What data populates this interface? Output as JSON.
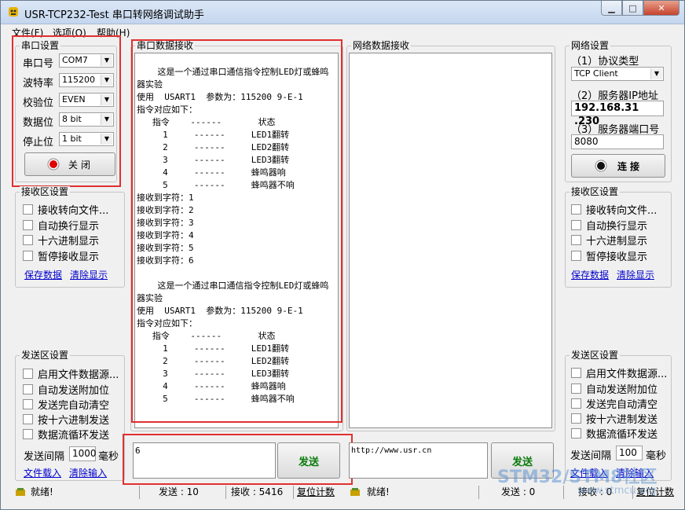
{
  "window": {
    "title": "USR-TCP232-Test 串口转网络调试助手"
  },
  "menu": [
    "文件(F)",
    "选项(O)",
    "帮助(H)"
  ],
  "serial_settings": {
    "title": "串口设置",
    "port_label": "串口号",
    "port_value": "COM7",
    "baud_label": "波特率",
    "baud_value": "115200",
    "parity_label": "校验位",
    "parity_value": "EVEN",
    "databits_label": "数据位",
    "databits_value": "8 bit",
    "stopbits_label": "停止位",
    "stopbits_value": "1 bit",
    "close_button": "关闭"
  },
  "left_receive": {
    "title": "接收区设置",
    "options": [
      "接收转向文件...",
      "自动换行显示",
      "十六进制显示",
      "暂停接收显示"
    ],
    "save_link": "保存数据",
    "clear_link": "清除显示"
  },
  "left_send": {
    "title": "发送区设置",
    "options": [
      "启用文件数据源...",
      "自动发送附加位",
      "发送完自动清空",
      "按十六进制发送",
      "数据流循环发送"
    ],
    "interval_label": "发送间隔",
    "interval_value": "1000",
    "interval_unit": "毫秒",
    "load_link": "文件载入",
    "clear_link": "清除输入"
  },
  "serial_receive": {
    "title": "串口数据接收",
    "content": "\n    这是一个通过串口通信指令控制LED灯或蜂鸣\n器实验\n使用  USART1  参数为：115200 9-E-1\n指令对应如下：\n   指令    ------       状态\n     1     ------     LED1翻转\n     2     ------     LED2翻转\n     3     ------     LED3翻转\n     4     ------     蜂鸣器响\n     5     ------     蜂鸣器不响\n接收到字符：1\n接收到字符：2\n接收到字符：3\n接收到字符：4\n接收到字符：5\n接收到字符：6\n\n    这是一个通过串口通信指令控制LED灯或蜂鸣\n器实验\n使用  USART1  参数为：115200 9-E-1\n指令对应如下：\n   指令    ------       状态\n     1     ------     LED1翻转\n     2     ------     LED2翻转\n     3     ------     LED3翻转\n     4     ------     蜂鸣器响\n     5     ------     蜂鸣器不响"
  },
  "network_receive": {
    "title": "网络数据接收"
  },
  "serial_send": {
    "input_value": "6",
    "send_button": "发送"
  },
  "network_send": {
    "input_value": "http://www.usr.cn",
    "send_button": "发送"
  },
  "network_settings": {
    "title": "网络设置",
    "protocol_label": "（1）协议类型",
    "protocol_value": "TCP Client",
    "ip_label": "（2）服务器IP地址",
    "ip_value": "192.168.31 .230",
    "port_label": "（3）服务器端口号",
    "port_value": "8080",
    "connect_button": "连接"
  },
  "right_receive": {
    "title": "接收区设置",
    "options": [
      "接收转向文件...",
      "自动换行显示",
      "十六进制显示",
      "暂停接收显示"
    ],
    "save_link": "保存数据",
    "clear_link": "清除显示"
  },
  "right_send": {
    "title": "发送区设置",
    "options": [
      "启用文件数据源...",
      "自动发送附加位",
      "发送完自动清空",
      "按十六进制发送",
      "数据流循环发送"
    ],
    "interval_label": "发送间隔",
    "interval_value": "100",
    "interval_unit": "毫秒",
    "load_link": "文件载入",
    "clear_link": "清除输入"
  },
  "status_left": {
    "ready": "就绪!",
    "sent": "发送 : 10",
    "received": "接收 : 5416",
    "reset": "复位计数"
  },
  "status_right": {
    "ready": "就绪!",
    "sent": "发送 : 0",
    "received": "接收 : 0",
    "reset": "复位计数"
  },
  "watermark": {
    "main": "STM32/STM8社区",
    "sub": "www.stmcu.org"
  },
  "colors": {
    "highlight": "#e03030",
    "link": "#0000cc",
    "send_green": "#0a7a0a"
  }
}
